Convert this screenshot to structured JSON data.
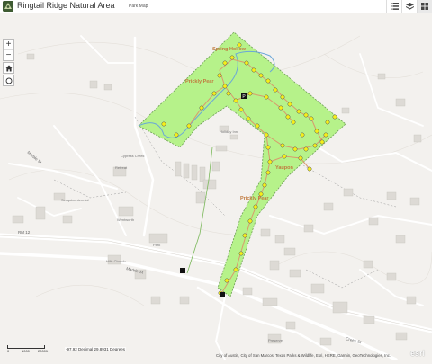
{
  "header": {
    "title": "Ringtail Ridge Natural Area",
    "subtitle": "Park Map",
    "tools": [
      {
        "icon": "list-icon",
        "name": "legend-button"
      },
      {
        "icon": "layers-icon",
        "name": "layers-button"
      },
      {
        "icon": "basemap-grid-icon",
        "name": "basemap-button"
      }
    ]
  },
  "map_controls": {
    "zoom_in": "+",
    "zoom_out": "−"
  },
  "map_labels": {
    "prickly_pear_trail": "Prickly Pear",
    "prickly_pear_trail_2": "Prickly Pear",
    "spring_hollow": "Spring Hollow",
    "yaupon": "Yaupon",
    "marble_st": "Marble St",
    "marble_st_2": "Marble St",
    "rm_12": "RM 12",
    "holiday_inn": "Holiday Inn",
    "cypress_creek": "Cypress Creek",
    "retreat": "Retreat",
    "sesquicentennial": "Sesquicentennial",
    "wentworth": "Wentworth",
    "park": "Park",
    "hills_church": "Hills Church",
    "creek_street": "Creek St",
    "preserve": "Preserve"
  },
  "scale": {
    "left": "0",
    "mid": "1000",
    "right": "2000ft"
  },
  "coordinates": "-97.92 Decimal 29.8931 Degrees",
  "attribution": "City of Austin, City of San Marcos, Texas Parks & Wildlife, Esri, HERE, Garmin, GeoTechnologies, Inc.",
  "brand": "esri",
  "colors": {
    "park_fill": "#b6f28a",
    "park_border": "#6d9e55",
    "trail": "#d99a6c",
    "creek": "#6aa7d8",
    "marker": "#f5ee1a"
  }
}
